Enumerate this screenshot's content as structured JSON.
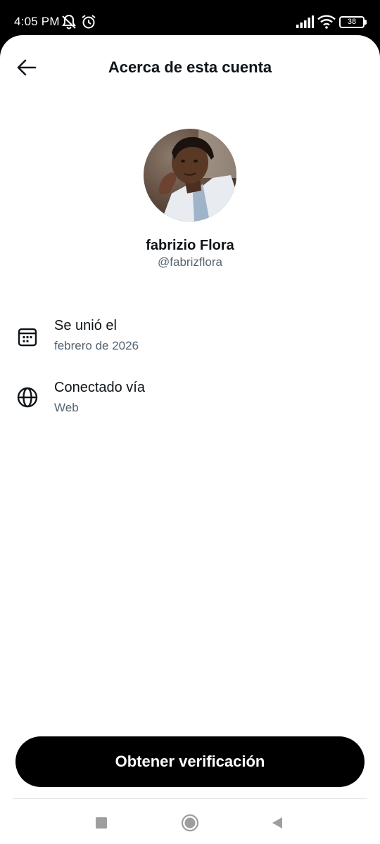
{
  "status_bar": {
    "time": "4:05 PM",
    "battery": "38",
    "icons": [
      "muted-notifications-icon",
      "alarm-icon",
      "signal-icon",
      "wifi-icon",
      "battery-icon"
    ]
  },
  "header": {
    "title": "Acerca de esta cuenta",
    "back_icon": "back-arrow-icon"
  },
  "profile": {
    "display_name": "fabrizio Flora",
    "handle": "@fabrizflora"
  },
  "info": [
    {
      "icon": "calendar-icon",
      "label": "Se unió el",
      "value": "febrero de 2026"
    },
    {
      "icon": "globe-icon",
      "label": "Conectado vía",
      "value": "Web"
    }
  ],
  "cta": {
    "label": "Obtener verificación"
  },
  "nav_bar": {
    "buttons": [
      "recents-square-icon",
      "home-circle-icon",
      "back-triangle-icon"
    ]
  },
  "colors": {
    "primary_text": "#0f1419",
    "secondary_text": "#536471",
    "button_bg": "#000000",
    "button_text": "#ffffff"
  }
}
